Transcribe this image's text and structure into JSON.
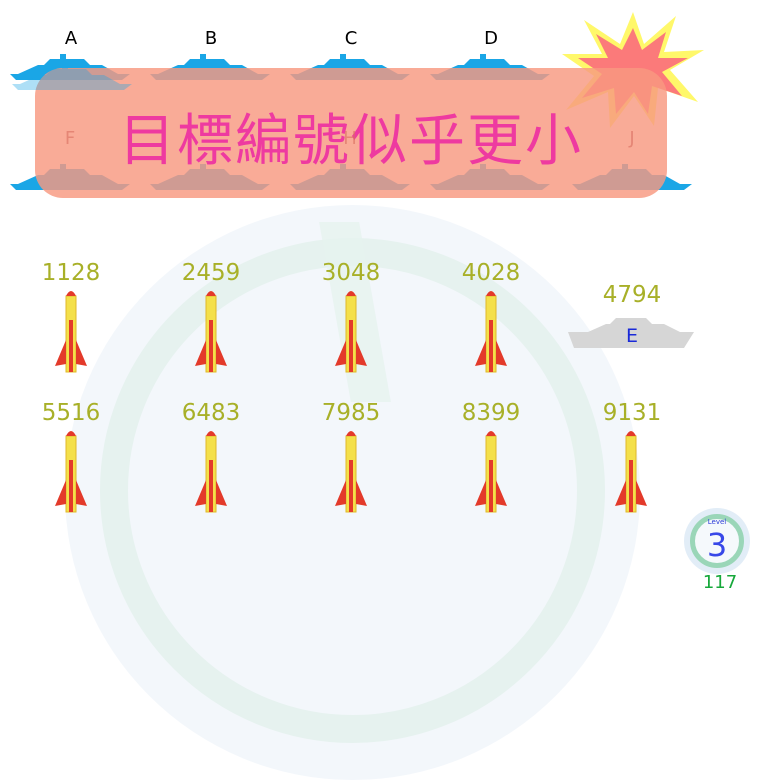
{
  "ships_top": [
    "A",
    "B",
    "C",
    "D",
    "E"
  ],
  "ships_bottom": [
    "F",
    "G",
    "H",
    "I",
    "J"
  ],
  "banner": {
    "message": "目標編號似乎更小"
  },
  "targets_row1": [
    "1128",
    "2459",
    "3048",
    "4028"
  ],
  "target_hit": {
    "number": "4794",
    "label": "E"
  },
  "targets_row2": [
    "5516",
    "6483",
    "7985",
    "8399",
    "9131"
  ],
  "level": {
    "word": "Level",
    "value": "3"
  },
  "score": "117",
  "colors": {
    "ship_blue": "#1aa6e6",
    "number": "#a8b028",
    "banner": "#f89880",
    "banner_text": "#ee3aa0"
  }
}
